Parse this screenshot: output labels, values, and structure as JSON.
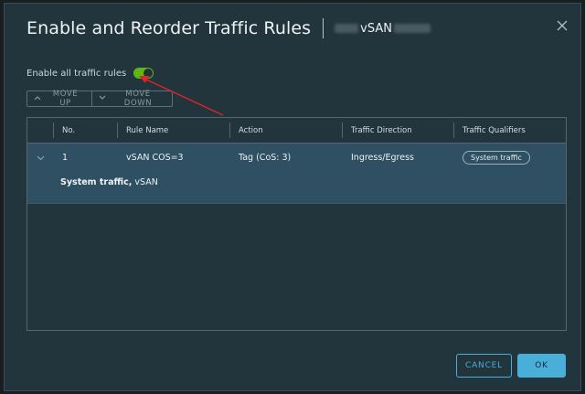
{
  "dialog": {
    "title": "Enable and Reorder Traffic Rules",
    "subtitle": "vSAN",
    "close_icon": "close-icon"
  },
  "toggle": {
    "label": "Enable all traffic rules",
    "state": "on",
    "accent": "#5eb715"
  },
  "toolbar": {
    "move_up": "MOVE UP",
    "move_down": "MOVE DOWN"
  },
  "table": {
    "columns": [
      "No.",
      "Rule Name",
      "Action",
      "Traffic Direction",
      "Traffic Qualifiers"
    ],
    "rows": [
      {
        "no": "1",
        "rule_name": "vSAN COS=3",
        "action": "Tag (CoS: 3)",
        "direction": "Ingress/Egress",
        "qualifier": "System traffic",
        "detail_label": "System traffic,",
        "detail_value": "vSAN"
      }
    ]
  },
  "footer": {
    "cancel": "CANCEL",
    "ok": "OK"
  },
  "colors": {
    "dialog_bg": "#22343c",
    "selected_row": "#2e5062",
    "primary": "#49afd9",
    "annotation_arrow": "#e0242a"
  }
}
